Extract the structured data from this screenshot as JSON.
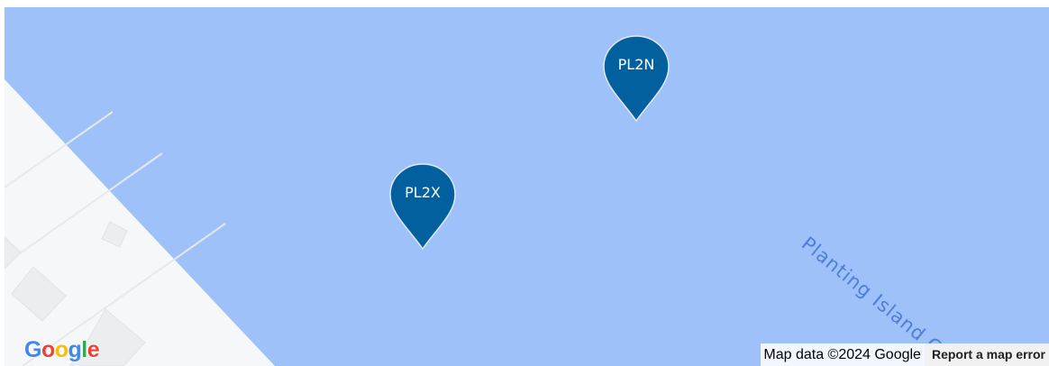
{
  "map": {
    "water_label": "Planting Island C",
    "colors": {
      "water": "#9fc1fa",
      "land": "#f6f7f8",
      "marker": "#03609f",
      "water_label": "#4f7ed6"
    }
  },
  "markers": [
    {
      "label": "PL2N",
      "icon": "map-pin-icon"
    },
    {
      "label": "PL2X",
      "icon": "map-pin-icon"
    }
  ],
  "branding": {
    "logo_text": "Google",
    "logo_letters": [
      {
        "ch": "G",
        "color": "#4285f4"
      },
      {
        "ch": "o",
        "color": "#ea4335"
      },
      {
        "ch": "o",
        "color": "#fbbc05"
      },
      {
        "ch": "g",
        "color": "#4285f4"
      },
      {
        "ch": "l",
        "color": "#34a853"
      },
      {
        "ch": "e",
        "color": "#ea4335"
      }
    ]
  },
  "attribution": {
    "map_data": "Map data ©2024 Google",
    "report_link": "Report a map error"
  }
}
